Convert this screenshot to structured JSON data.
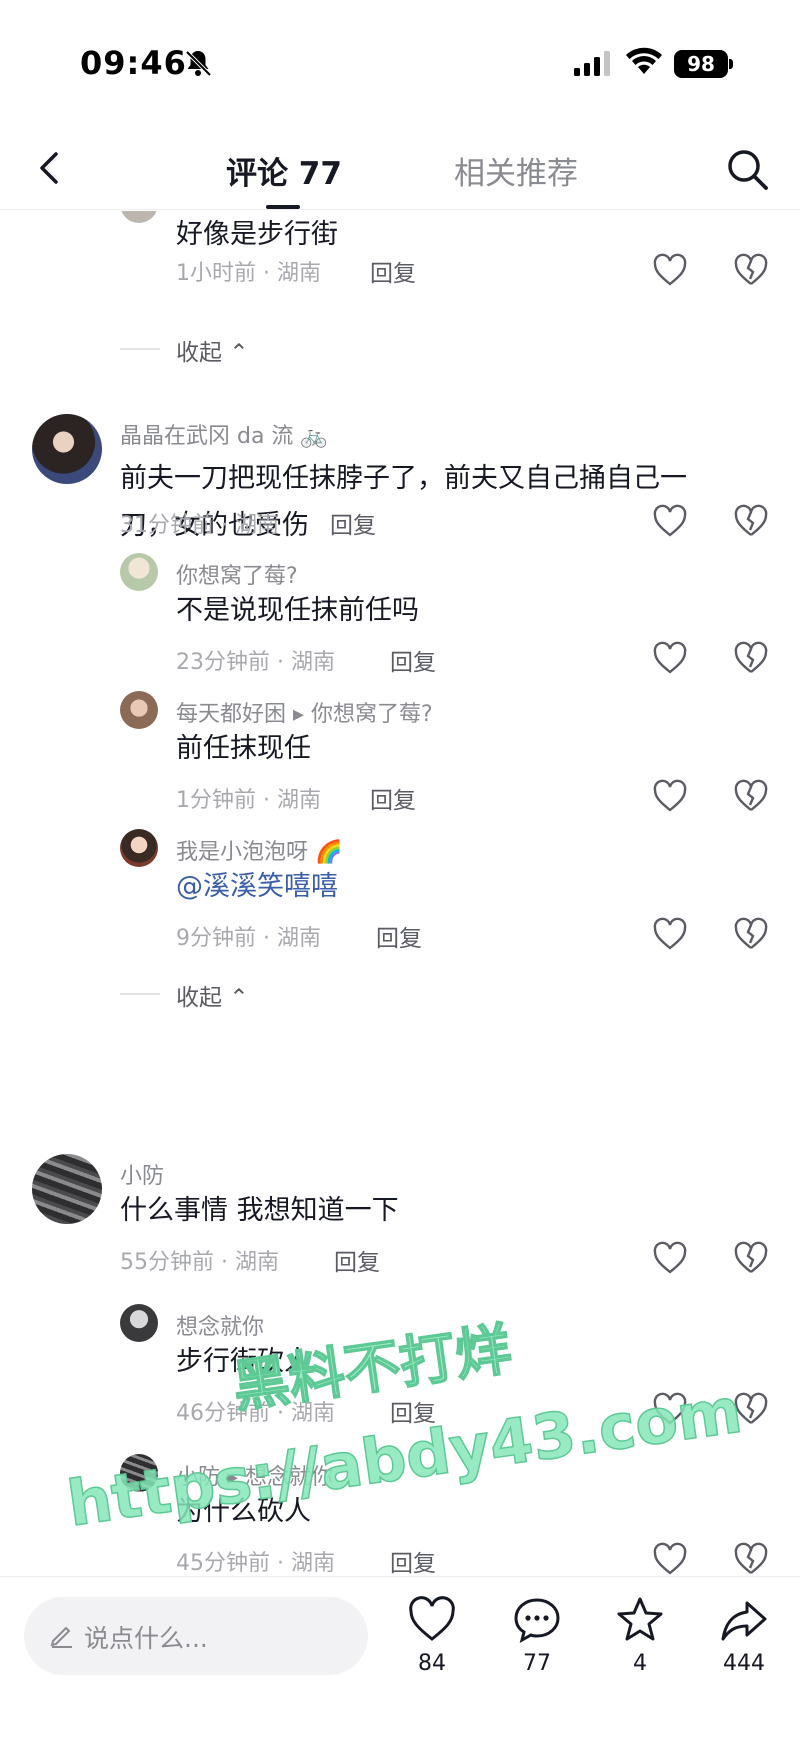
{
  "status_bar": {
    "time": "09:46",
    "battery": "98"
  },
  "header": {
    "tab_comments": "评论 77",
    "tab_related": "相关推荐"
  },
  "comments": {
    "top_reply": {
      "text": "好像是步行街",
      "meta": "1小时前 · 湖南",
      "reply": "回复"
    },
    "collapse_1": "收起",
    "c1": {
      "name": "晶晶在武冈 da 流",
      "text_line1": "前夫一刀把现任抹脖子了，前夫又自己捅自己一",
      "text_line2": "刀，女的也受伤",
      "meta": "31分钟前 · 湖南",
      "reply": "回复",
      "replies": [
        {
          "name": "你想窝了莓?",
          "text": "不是说现任抹前任吗",
          "meta": "23分钟前 · 湖南",
          "reply": "回复"
        },
        {
          "name": "每天都好困",
          "reply_to": "你想窝了莓?",
          "text": "前任抹现任",
          "meta": "1分钟前 · 湖南",
          "reply": "回复"
        },
        {
          "name": "我是小泡泡呀",
          "text": "@溪溪笑嘻嘻",
          "meta": "9分钟前 · 湖南",
          "reply": "回复"
        }
      ]
    },
    "collapse_2": "收起",
    "c2": {
      "name": "小防",
      "text": "什么事情 我想知道一下",
      "meta": "55分钟前 · 湖南",
      "reply": "回复",
      "replies": [
        {
          "name": "想念就你",
          "text": "步行街砍人",
          "meta": "46分钟前 · 湖南",
          "reply": "回复"
        },
        {
          "name": "小防",
          "reply_to": "想念就你",
          "text": "为什么砍人",
          "meta": "45分钟前 · 湖南",
          "reply": "回复"
        }
      ]
    }
  },
  "watermark": {
    "line1": "黑料不打烊",
    "line2": "https://abdy43.com"
  },
  "bottom_bar": {
    "input_placeholder": "说点什么...",
    "likes": "84",
    "comments": "77",
    "favorites": "4",
    "shares": "444"
  },
  "colors": {
    "text": "#161823",
    "secondary": "#8a8b91",
    "mention": "#3a5fa8"
  }
}
